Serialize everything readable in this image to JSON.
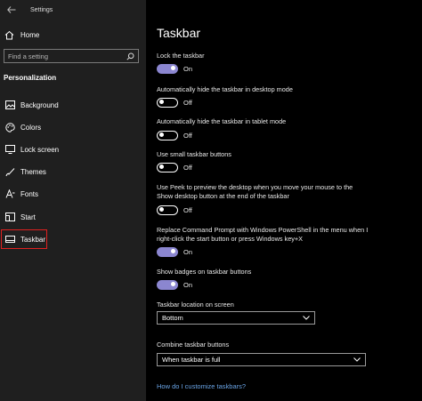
{
  "window": {
    "title": "Settings"
  },
  "sidebar": {
    "home_label": "Home",
    "search_placeholder": "Find a setting",
    "section_title": "Personalization",
    "items": [
      {
        "label": "Background",
        "icon": "image-icon"
      },
      {
        "label": "Colors",
        "icon": "palette-icon"
      },
      {
        "label": "Lock screen",
        "icon": "lock-screen-icon"
      },
      {
        "label": "Themes",
        "icon": "brush-icon"
      },
      {
        "label": "Fonts",
        "icon": "font-icon"
      },
      {
        "label": "Start",
        "icon": "start-icon"
      },
      {
        "label": "Taskbar",
        "icon": "taskbar-icon",
        "selected": true
      }
    ]
  },
  "main": {
    "title": "Taskbar",
    "settings": [
      {
        "label": "Lock the taskbar",
        "state": "On"
      },
      {
        "label": "Automatically hide the taskbar in desktop mode",
        "state": "Off"
      },
      {
        "label": "Automatically hide the taskbar in tablet mode",
        "state": "Off"
      },
      {
        "label": "Use small taskbar buttons",
        "state": "Off"
      },
      {
        "label": "Use Peek to preview the desktop when you move your mouse to the Show desktop button at the end of the taskbar",
        "state": "Off"
      },
      {
        "label": "Replace Command Prompt with Windows PowerShell in the menu when I right-click the start button or press Windows key+X",
        "state": "On"
      },
      {
        "label": "Show badges on taskbar buttons",
        "state": "On"
      }
    ],
    "location": {
      "label": "Taskbar location on screen",
      "value": "Bottom"
    },
    "combine": {
      "label": "Combine taskbar buttons",
      "value": "When taskbar is full"
    },
    "help_link": "How do I customize taskbars?"
  },
  "colors": {
    "accent": "#8b86d0",
    "selection_outline": "#e0201f",
    "link": "#6aa4e6"
  }
}
